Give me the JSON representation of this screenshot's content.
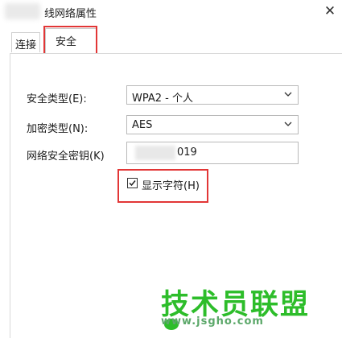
{
  "window": {
    "title": "无线网络属性",
    "visible_title": "线网络属性",
    "close_symbol": "✕"
  },
  "tabs": [
    {
      "label": "连接",
      "selected": false
    },
    {
      "label": "安全",
      "selected": true
    }
  ],
  "security": {
    "type_label": "安全类型(E):",
    "type_value": "WPA2 - 个人",
    "encryption_label": "加密类型(N):",
    "encryption_value": "AES",
    "key_label": "网络安全密钥(K)",
    "key_value": "019",
    "show_chars_label": "显示字符(H)",
    "show_chars_checked": true
  },
  "watermark": {
    "logo_text": "技术员联盟",
    "url": "www.jsgho.com"
  },
  "colors": {
    "highlight_red": "#e23636",
    "watermark_green": "#2dbd2a"
  }
}
